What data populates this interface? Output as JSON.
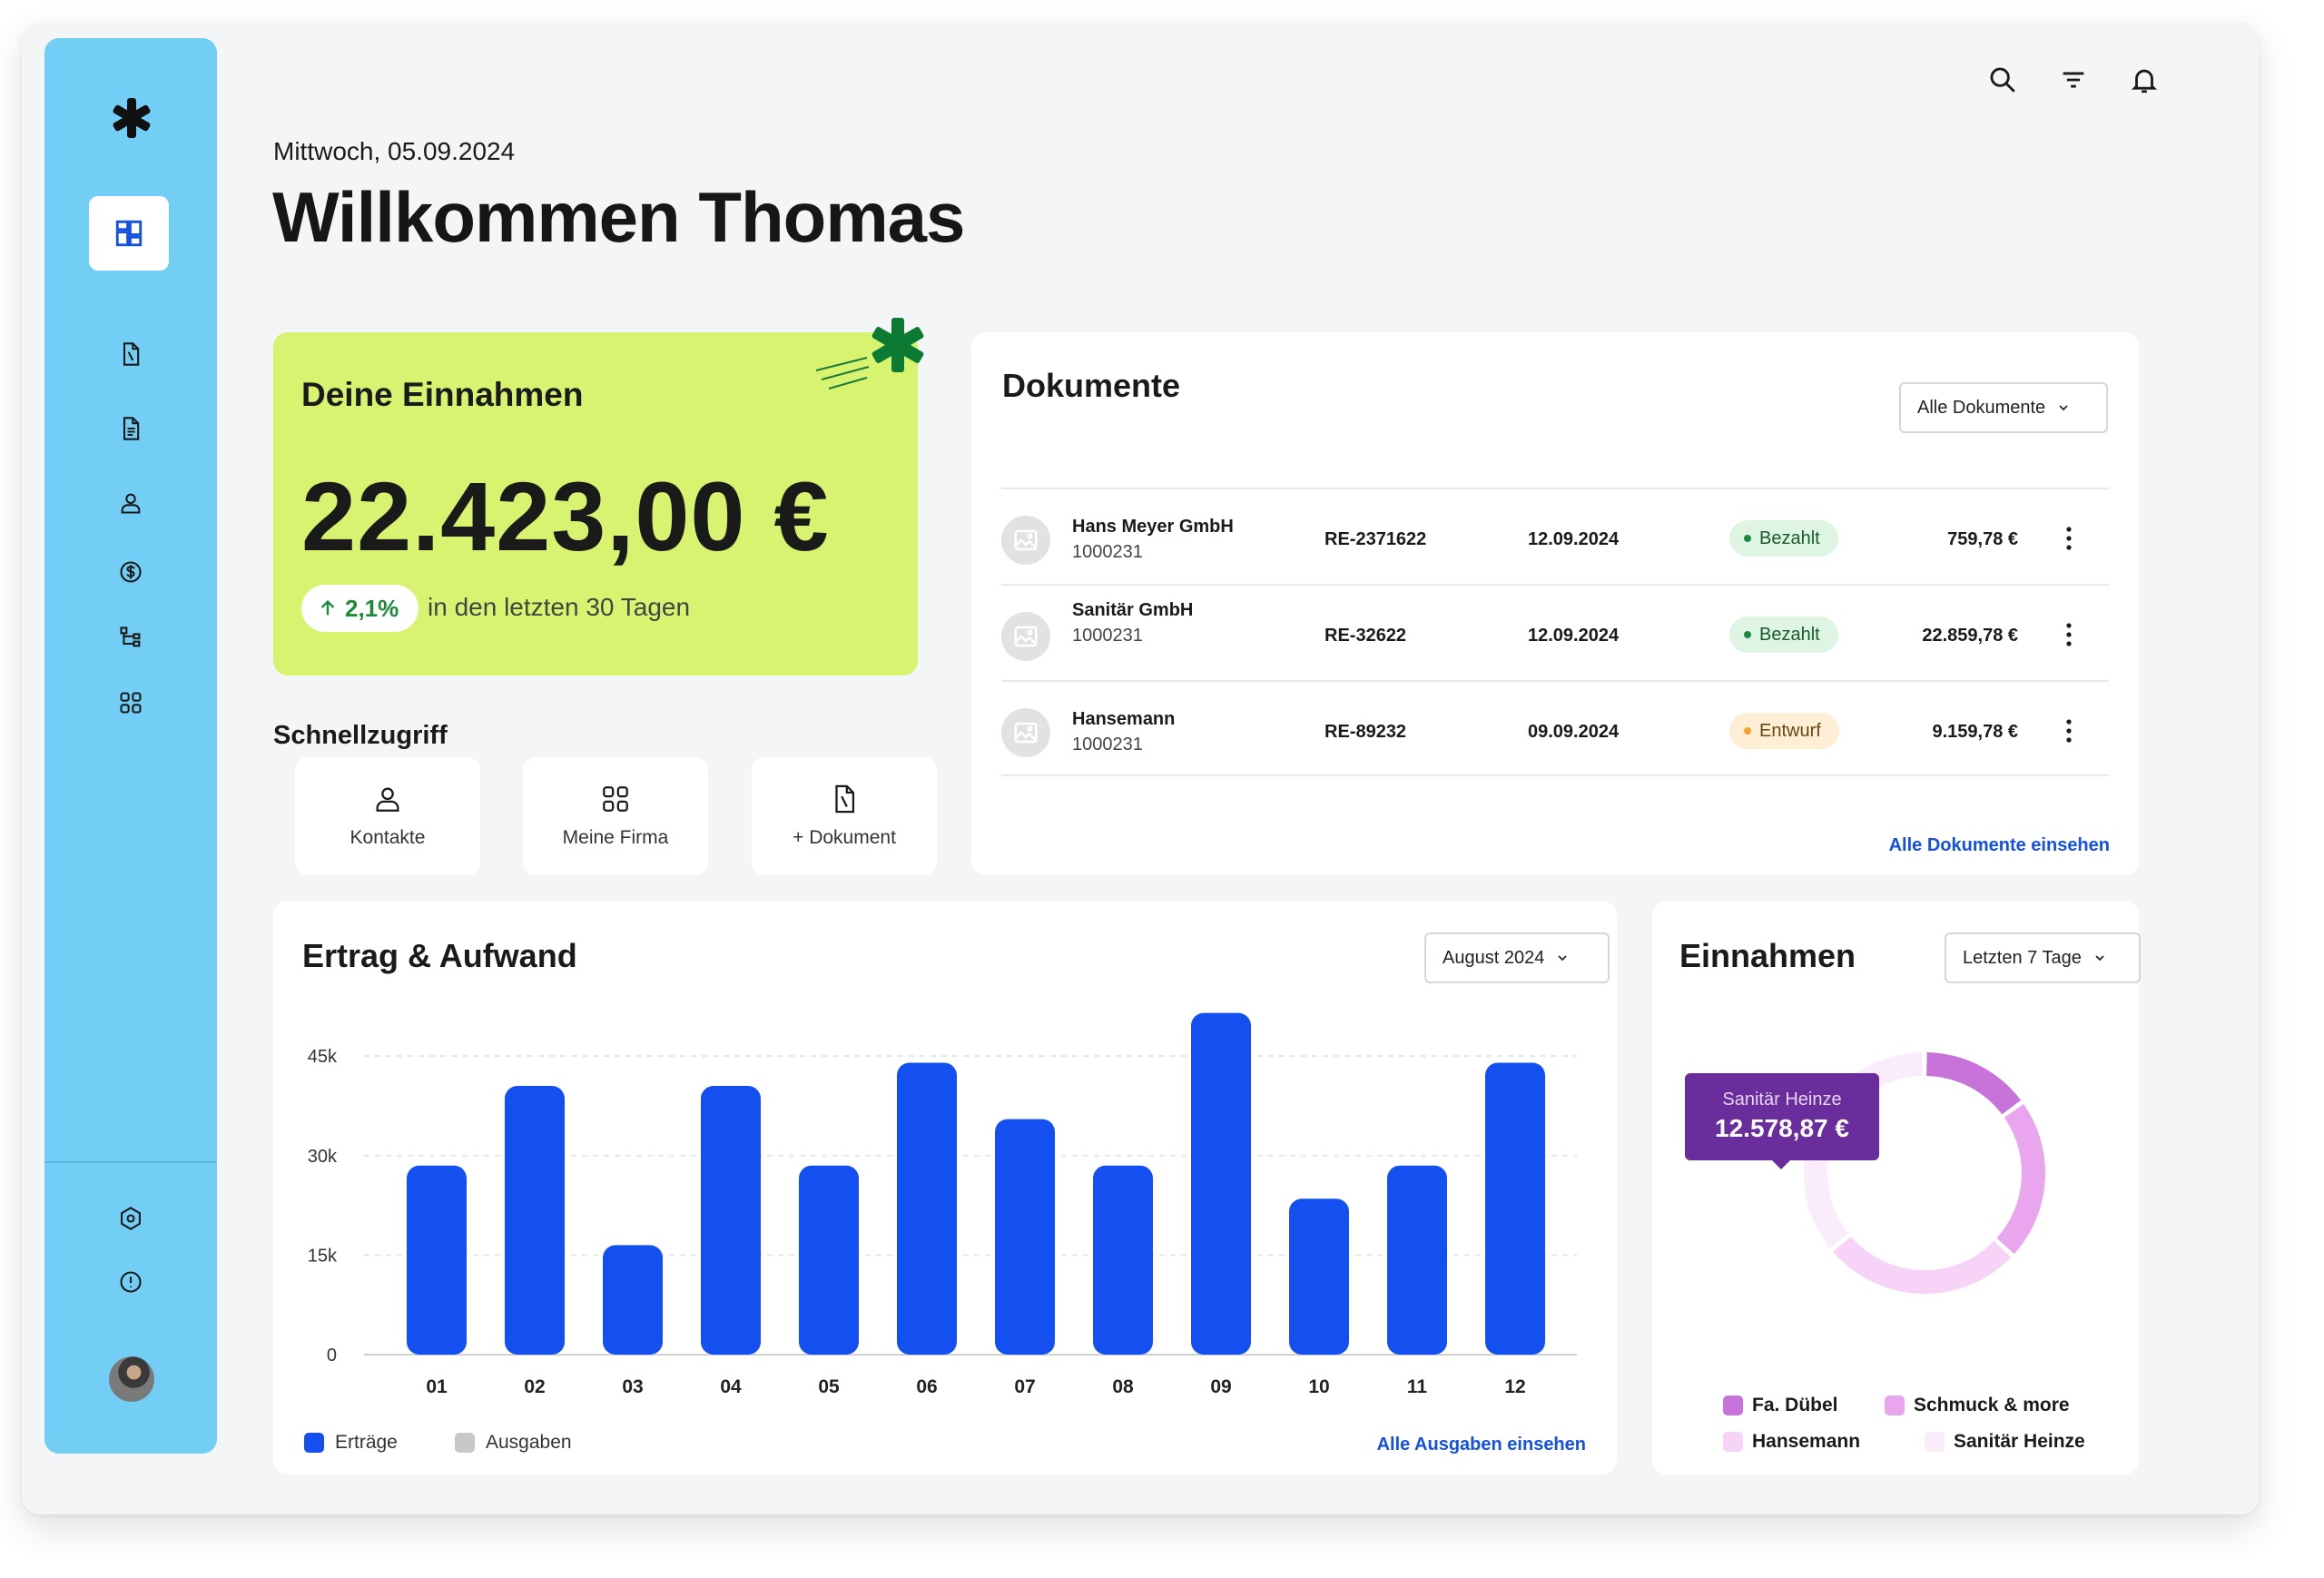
{
  "header": {
    "date": "Mittwoch, 05.09.2024",
    "title": "Willkommen Thomas"
  },
  "sidebar": {
    "items": [
      {
        "icon": "dashboard-icon"
      },
      {
        "icon": "document-icon"
      },
      {
        "icon": "invoice-icon"
      },
      {
        "icon": "user-icon"
      },
      {
        "icon": "dollar-icon"
      },
      {
        "icon": "hierarchy-icon"
      },
      {
        "icon": "apps-icon"
      },
      {
        "icon": "settings-icon"
      },
      {
        "icon": "info-icon"
      }
    ]
  },
  "income": {
    "label": "Deine Einnahmen",
    "value": "22.423,00 €",
    "change": "2,1%",
    "period": "in den letzten 30 Tagen"
  },
  "quick_access": {
    "label": "Schnellzugriff",
    "items": [
      {
        "label": "Kontakte",
        "icon": "user-icon"
      },
      {
        "label": "Meine Firma",
        "icon": "apps-icon"
      },
      {
        "label": "+ Dokument",
        "icon": "document-icon"
      }
    ]
  },
  "documents": {
    "title": "Dokumente",
    "filter": "Alle Dokumente",
    "rows": [
      {
        "name": "Hans Meyer GmbH",
        "number": "1000231",
        "id": "RE-2371622",
        "date": "12.09.2024",
        "status": "Bezahlt",
        "amount": "759,78 €"
      },
      {
        "name": "Sanitär GmbH",
        "number": "1000231",
        "id": "RE-32622",
        "date": "12.09.2024",
        "status": "Bezahlt",
        "amount": "22.859,78 €"
      },
      {
        "name": "Hansemann",
        "number": "1000231",
        "id": "RE-89232",
        "date": "09.09.2024",
        "status": "Entwurf",
        "amount": "9.159,78 €"
      }
    ],
    "link": "Alle Dokumente einsehen"
  },
  "revenue": {
    "title": "Ertrag & Aufwand",
    "filter": "August 2024",
    "legend": [
      "Erträge",
      "Ausgaben"
    ],
    "link": "Alle Ausgaben einsehen"
  },
  "chart_data": {
    "type": "bar",
    "categories": [
      "01",
      "02",
      "03",
      "04",
      "05",
      "06",
      "07",
      "08",
      "09",
      "10",
      "11",
      "12"
    ],
    "series": [
      {
        "name": "Erträge",
        "values": [
          28500,
          40500,
          16500,
          40500,
          28500,
          44000,
          35500,
          28500,
          51500,
          23500,
          28500,
          44000
        ]
      }
    ],
    "yticks": [
      "0",
      "15k",
      "30k",
      "45k"
    ],
    "ylim": [
      0,
      52000
    ],
    "colors": {
      "Erträge": "#1450f0",
      "Ausgaben": "#c8c8c8"
    }
  },
  "einnahmen": {
    "title": "Einnahmen",
    "filter": "Letzten 7 Tage",
    "tooltip_name": "Sanitär Heinze",
    "tooltip_value": "12.578,87 €",
    "legend": [
      {
        "name": "Fa. Dübel",
        "color": "#c873d9",
        "value": 15
      },
      {
        "name": "Schmuck & more",
        "color": "#e9a6ee",
        "value": 22
      },
      {
        "name": "Hansemann",
        "color": "#f6d3f7",
        "value": 27
      },
      {
        "name": "Sanitär Heinze",
        "color": "#fbecfb",
        "value": 36
      }
    ]
  }
}
